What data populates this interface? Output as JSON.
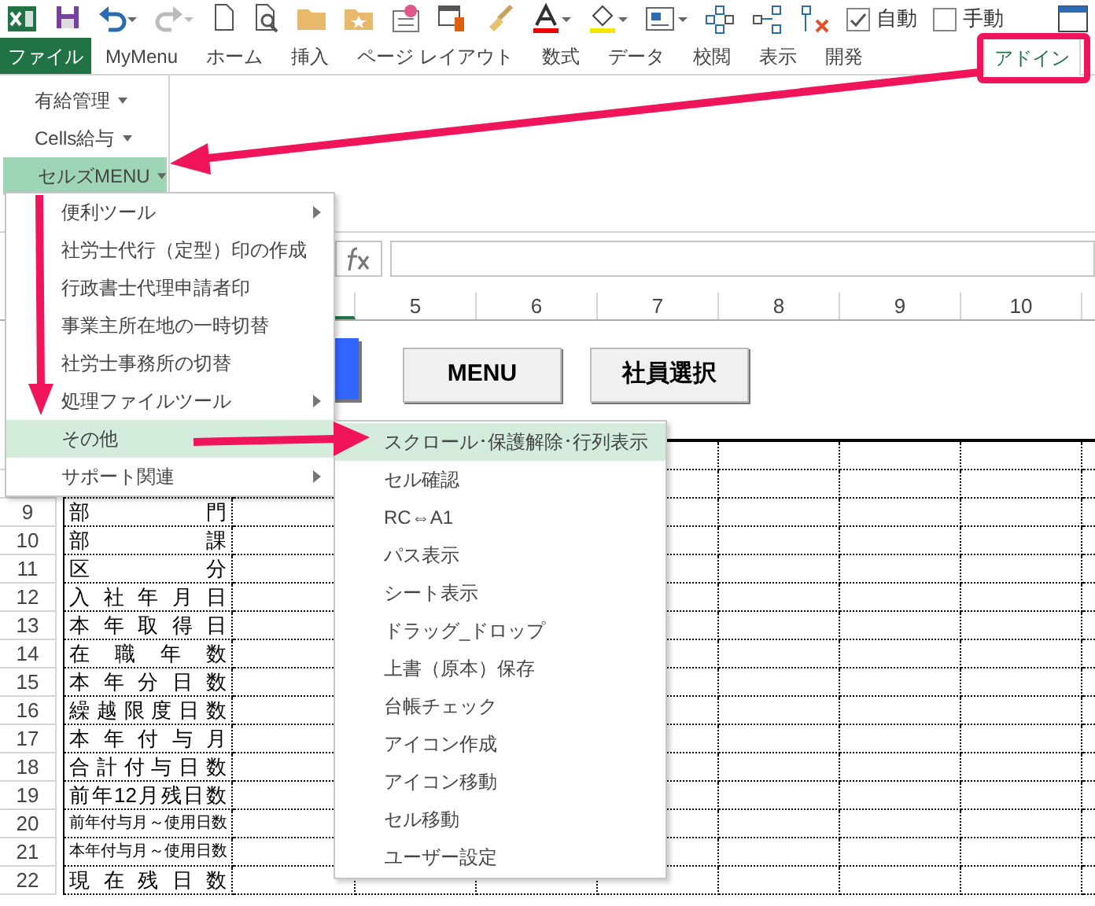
{
  "quick_access": {
    "checkboxes": [
      {
        "label": "自動",
        "checked": true
      },
      {
        "label": "手動",
        "checked": false
      }
    ]
  },
  "ribbon_tabs": [
    {
      "label": "ファイル",
      "kind": "file",
      "selected": false
    },
    {
      "label": "MyMenu",
      "kind": "tab",
      "selected": false
    },
    {
      "label": "ホーム",
      "kind": "tab",
      "selected": false
    },
    {
      "label": "挿入",
      "kind": "tab",
      "selected": false
    },
    {
      "label": "ページ レイアウト",
      "kind": "tab",
      "selected": false
    },
    {
      "label": "数式",
      "kind": "tab",
      "selected": false
    },
    {
      "label": "データ",
      "kind": "tab",
      "selected": false
    },
    {
      "label": "校閲",
      "kind": "tab",
      "selected": false
    },
    {
      "label": "表示",
      "kind": "tab",
      "selected": false
    },
    {
      "label": "開発",
      "kind": "tab",
      "selected": false
    },
    {
      "label": "アドイン",
      "kind": "tab",
      "selected": true
    }
  ],
  "ribbon_menus": [
    {
      "label": "有給管理",
      "selected": false
    },
    {
      "label": "Cells給与",
      "selected": false
    },
    {
      "label": "セルズMENU",
      "selected": true
    }
  ],
  "dropdown_menu": {
    "items": [
      {
        "label": "便利ツール",
        "has_submenu": true,
        "selected": false
      },
      {
        "label": "社労士代行（定型）印の作成",
        "has_submenu": false,
        "selected": false
      },
      {
        "label": "行政書士代理申請者印",
        "has_submenu": false,
        "selected": false
      },
      {
        "label": "事業主所在地の一時切替",
        "has_submenu": false,
        "selected": false
      },
      {
        "label": "社労士事務所の切替",
        "has_submenu": false,
        "selected": false
      },
      {
        "label": "処理ファイルツール",
        "has_submenu": true,
        "selected": false
      },
      {
        "label": "その他",
        "has_submenu": false,
        "selected": true
      },
      {
        "label": "サポート関連",
        "has_submenu": true,
        "selected": false
      }
    ]
  },
  "submenu": {
    "items": [
      {
        "label": "スクロール･保護解除･行列表示",
        "selected": true
      },
      {
        "label": "セル確認",
        "selected": false
      },
      {
        "label": "RC⇔A1",
        "selected": false
      },
      {
        "label": "パス表示",
        "selected": false
      },
      {
        "label": "シート表示",
        "selected": false
      },
      {
        "label": "ドラッグ_ドロップ",
        "selected": false
      },
      {
        "label": "上書（原本）保存",
        "selected": false
      },
      {
        "label": "台帳チェック",
        "selected": false
      },
      {
        "label": "アイコン作成",
        "selected": false
      },
      {
        "label": "アイコン移動",
        "selected": false
      },
      {
        "label": "セル移動",
        "selected": false
      },
      {
        "label": "ユーザー設定",
        "selected": false
      }
    ]
  },
  "sheet": {
    "column_headers": [
      "5",
      "6",
      "7",
      "8",
      "9",
      "10"
    ],
    "buttons": [
      "MENU",
      "社員選択"
    ],
    "rows": [
      {
        "number": "9",
        "label": "部門",
        "kind": "spread"
      },
      {
        "number": "10",
        "label": "部課",
        "kind": "spread"
      },
      {
        "number": "11",
        "label": "区分",
        "kind": "spread"
      },
      {
        "number": "12",
        "label": "入社年月日",
        "kind": "spread"
      },
      {
        "number": "13",
        "label": "本年取得日",
        "kind": "spread"
      },
      {
        "number": "14",
        "label": "在職年数",
        "kind": "spread"
      },
      {
        "number": "15",
        "label": "本年分日数",
        "kind": "spread"
      },
      {
        "number": "16",
        "label": "繰越限度日数",
        "kind": "spread"
      },
      {
        "number": "17",
        "label": "本年付与月",
        "kind": "spread"
      },
      {
        "number": "18",
        "label": "合計付与日数",
        "kind": "spread"
      },
      {
        "number": "19",
        "label": "前年12月残日数",
        "kind": "spread"
      },
      {
        "number": "20",
        "label": "前年付与月～使用日数",
        "kind": "small"
      },
      {
        "number": "21",
        "label": "本年付与月～使用日数",
        "kind": "small"
      },
      {
        "number": "22",
        "label": "現在残日数",
        "kind": "spread"
      }
    ]
  }
}
